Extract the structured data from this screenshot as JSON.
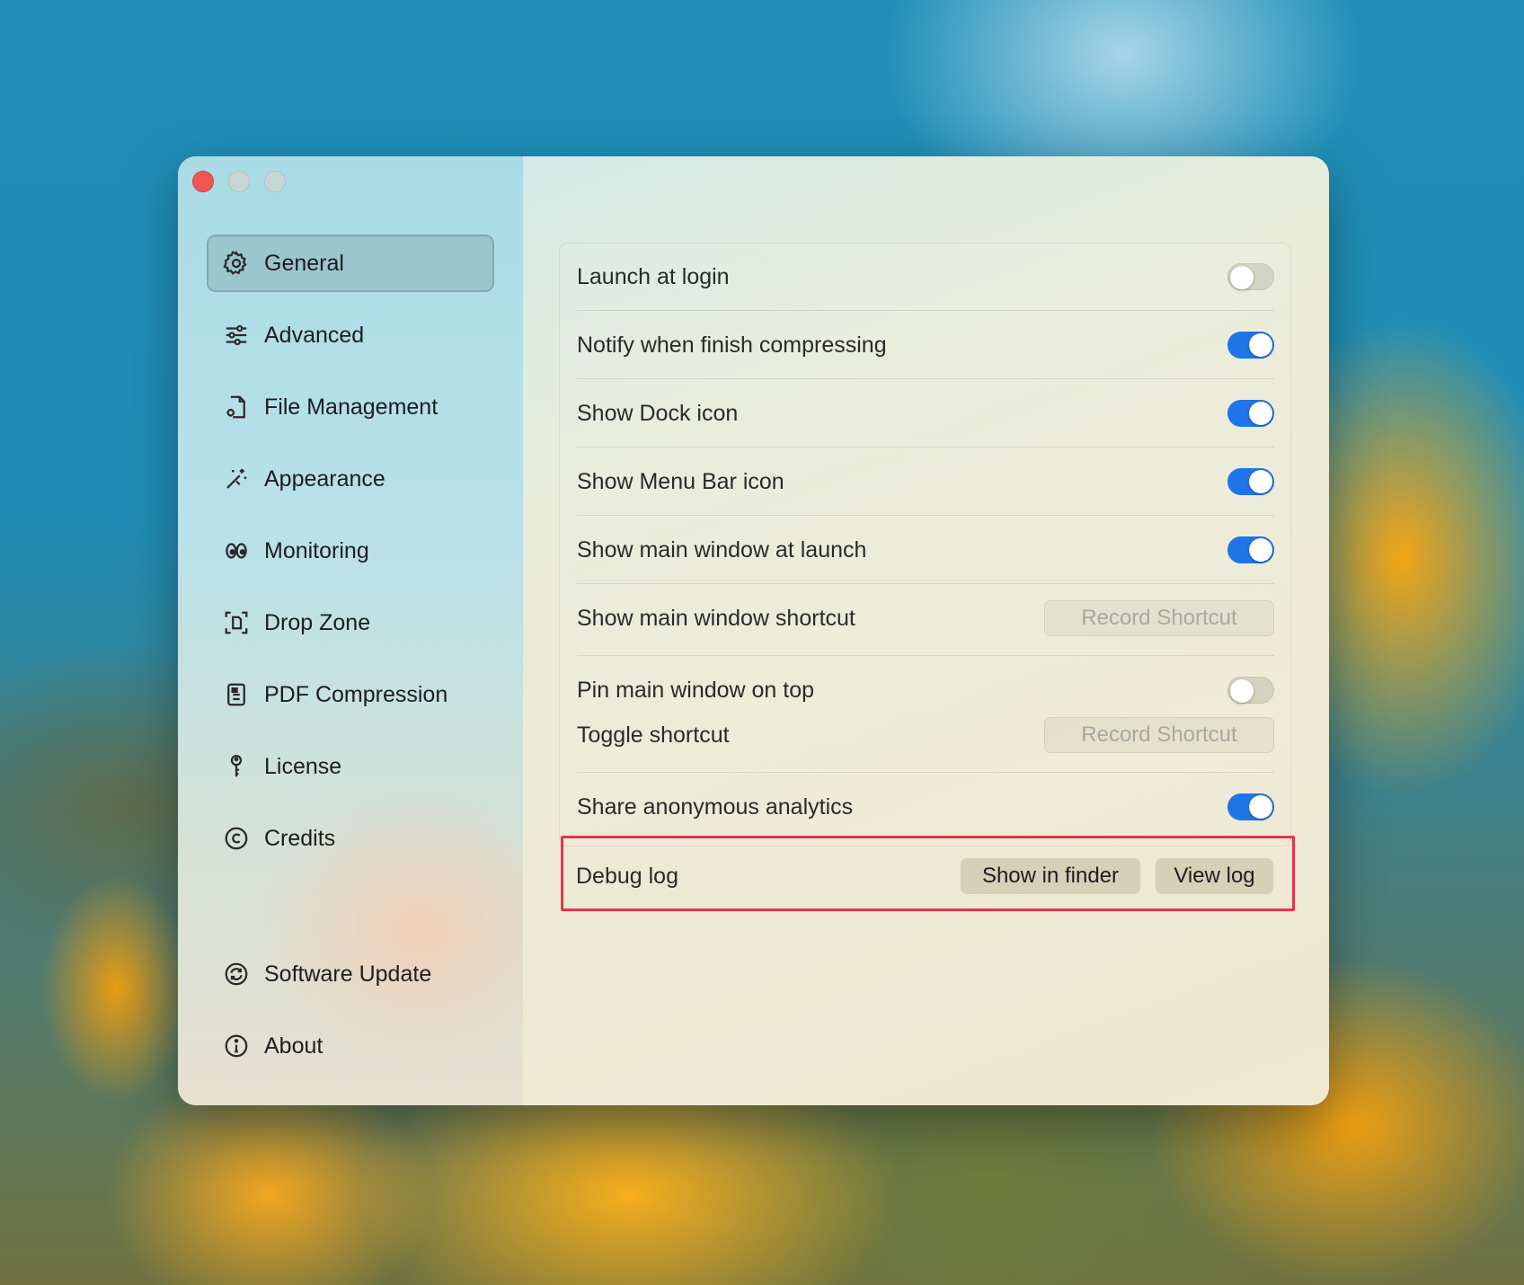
{
  "sidebar": {
    "items": [
      {
        "label": "General",
        "icon": "gear-icon",
        "active": true
      },
      {
        "label": "Advanced",
        "icon": "sliders-icon",
        "active": false
      },
      {
        "label": "File Management",
        "icon": "file-gear-icon",
        "active": false
      },
      {
        "label": "Appearance",
        "icon": "magic-wand-icon",
        "active": false
      },
      {
        "label": "Monitoring",
        "icon": "eyes-icon",
        "active": false
      },
      {
        "label": "Drop Zone",
        "icon": "drop-zone-icon",
        "active": false
      },
      {
        "label": "PDF Compression",
        "icon": "document-icon",
        "active": false
      },
      {
        "label": "License",
        "icon": "key-icon",
        "active": false
      },
      {
        "label": "Credits",
        "icon": "copyright-icon",
        "active": false
      }
    ],
    "bottom_items": [
      {
        "label": "Software Update",
        "icon": "refresh-icon"
      },
      {
        "label": "About",
        "icon": "info-icon"
      }
    ]
  },
  "settings": {
    "launch_at_login": {
      "label": "Launch at login",
      "on": false
    },
    "notify_finish": {
      "label": "Notify when finish compressing",
      "on": true
    },
    "show_dock_icon": {
      "label": "Show Dock icon",
      "on": true
    },
    "show_menu_bar_icon": {
      "label": "Show Menu Bar icon",
      "on": true
    },
    "show_main_window_launch": {
      "label": "Show main window at launch",
      "on": true
    },
    "show_main_window_shortcut": {
      "label": "Show main window shortcut",
      "button": "Record Shortcut"
    },
    "pin_main_window": {
      "label": "Pin main window on top",
      "on": false
    },
    "toggle_shortcut": {
      "label": "Toggle shortcut",
      "button": "Record Shortcut"
    },
    "share_analytics": {
      "label": "Share anonymous analytics",
      "on": true
    },
    "debug_log": {
      "label": "Debug log",
      "show_in_finder": "Show in finder",
      "view_log": "View log"
    }
  },
  "colors": {
    "toggle_on": "#1f74e8",
    "highlight": "#e8344a",
    "close_button": "#f0564f"
  }
}
